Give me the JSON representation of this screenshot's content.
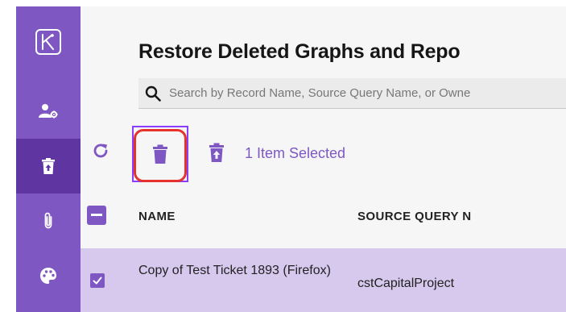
{
  "page": {
    "title": "Restore Deleted Graphs and Repo",
    "search_placeholder": "Search by Record Name, Source Query Name, or Owne"
  },
  "sidebar": {
    "items": [
      {
        "icon": "user-settings-icon"
      },
      {
        "icon": "restore-trash-icon",
        "active": true
      },
      {
        "icon": "paperclip-icon"
      },
      {
        "icon": "palette-icon"
      }
    ]
  },
  "toolbar": {
    "refresh_icon": "refresh-icon",
    "delete_icon": "trash-icon",
    "restore_icon": "restore-icon",
    "selected_text": "1 Item Selected"
  },
  "table": {
    "columns": [
      "NAME",
      "SOURCE QUERY N"
    ],
    "rows": [
      {
        "selected": true,
        "name": "Copy of Test Ticket 1893 (Firefox)",
        "source_query": "cstCapitalProject"
      }
    ]
  },
  "colors": {
    "accent": "#7e57c2",
    "sidebar_active": "#5e35a1",
    "selected_row": "#d7c8ee",
    "highlight_ring": "#e5322d"
  }
}
